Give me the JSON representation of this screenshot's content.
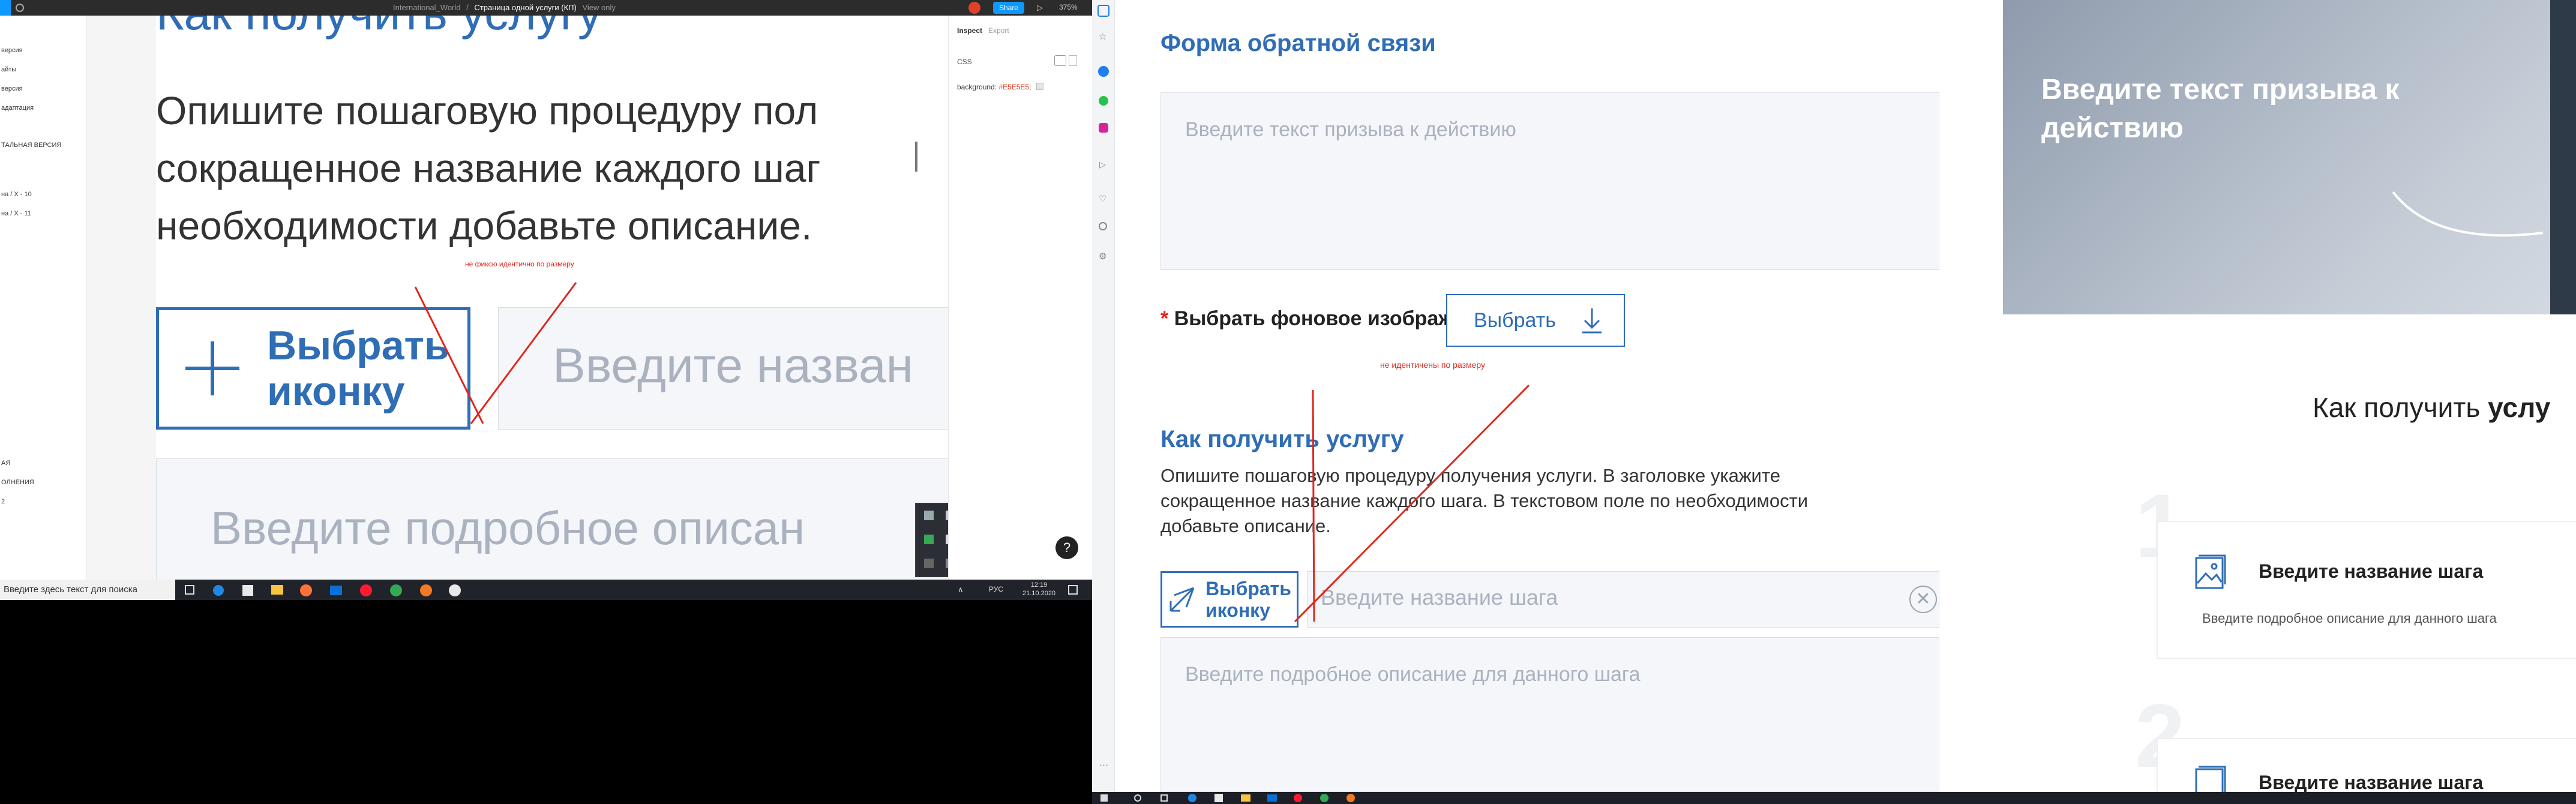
{
  "left": {
    "figma_bar": {
      "project": "International_World",
      "separator": "/",
      "page": "Страница одной услуги (КП)",
      "mode": "View only",
      "share": "Share",
      "zoom": "375%"
    },
    "sidebar_items": [
      "версия",
      "айты",
      "версия",
      "адаптация",
      "ТАЛЬНАЯ ВЕРСИЯ",
      "на / Х - 10",
      "на / Х - 11",
      "АЯ",
      "ОЛНЕНИЯ",
      "2"
    ],
    "canvas": {
      "heading_partial": "Как получить услугу",
      "description": "Опишите пошаговую процедуру пол... сокращенное название каждого шаг... необходимости добавьте описание.",
      "desc_line1": "Опишите пошаговую процедуру пол",
      "desc_line2": "сокращенное название каждого шаг",
      "desc_line3": "необходимости добавьте описание.",
      "annotation": "не фиксю идентично по размеру",
      "choose_icon_line1": "Выбрать",
      "choose_icon_line2": "иконку",
      "step_name_placeholder": "Введите назван",
      "step_desc_placeholder": "Введите подробное описан"
    },
    "inspect": {
      "tab_inspect": "Inspect",
      "tab_export": "Export",
      "css_label": "CSS",
      "background_label": "background:",
      "background_value": "#E5E5E5;"
    },
    "taskbar": {
      "search_placeholder": "Введите здесь текст для поиска",
      "lang": "РУС",
      "time": "12:19",
      "date": "21.10.2020"
    },
    "help_icon": "?"
  },
  "right": {
    "feedback_title": "Форма обратной связи",
    "cta_placeholder": "Введите текст призыва к действию",
    "bg_image_label": "Выбрать фоновое изображение:",
    "required_star": "*",
    "choose_button": "Выбрать",
    "annotation": "не идентичены по размеру",
    "section_title": "Как получить услугу",
    "section_desc": "Опишите пошаговую процедуру получения услуги. В заголовке укажите сокращенное название каждого шага. В текстовом поле по необходимости добавьте описание.",
    "choose_icon_line1": "Выбрать",
    "choose_icon_line2": "иконку",
    "step_name_placeholder": "Введите название шага",
    "step_desc_placeholder": "Введите подробное описание для данного шага",
    "preview": {
      "banner_text": "Введите текст призыва к действию",
      "section_heading_normal": "Как получить ",
      "section_heading_bold": "услу",
      "step1_number": "1",
      "step1_title": "Введите название шага",
      "step1_desc": "Введите подробное описание для данного шага",
      "step2_number": "2",
      "step2_title": "Введите название шага"
    }
  },
  "colors": {
    "accent": "#2f6db5",
    "annotation_red": "#e0261c",
    "input_bg": "#f4f6f9"
  }
}
